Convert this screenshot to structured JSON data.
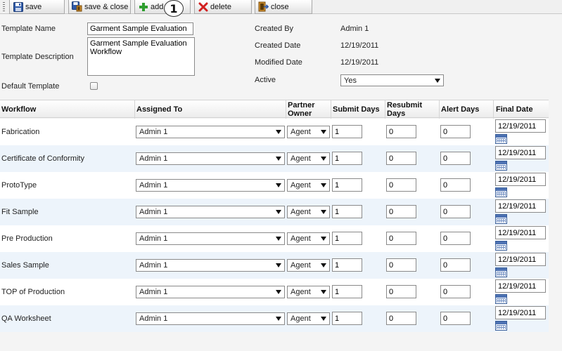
{
  "toolbar": {
    "save": "save",
    "save_close": "save & close",
    "add": "add",
    "delete": "delete",
    "close": "close",
    "badge": "1"
  },
  "form": {
    "template_name_label": "Template Name",
    "template_name_value": "Garment Sample Evaluation",
    "template_description_label": "Template Description",
    "template_description_value": "Garment Sample Evaluation Workflow",
    "default_template_label": "Default Template",
    "created_by_label": "Created By",
    "created_by_value": "Admin 1",
    "created_date_label": "Created Date",
    "created_date_value": "12/19/2011",
    "modified_date_label": "Modified Date",
    "modified_date_value": "12/19/2011",
    "active_label": "Active",
    "active_value": "Yes"
  },
  "grid": {
    "headers": {
      "workflow": "Workflow",
      "assigned_to": "Assigned To",
      "partner_owner_1": "Partner",
      "partner_owner_2": "Owner",
      "submit_days": "Submit Days",
      "resubmit_days_1": "Resubmit",
      "resubmit_days_2": "Days",
      "alert_days": "Alert Days",
      "final_date": "Final Date"
    },
    "rows": [
      {
        "workflow": "Fabrication",
        "assigned_to": "Admin 1",
        "partner_owner": "Agent",
        "submit_days": "1",
        "resubmit_days": "0",
        "alert_days": "0",
        "final_date": "12/19/2011"
      },
      {
        "workflow": "Certificate of Conformity",
        "assigned_to": "Admin 1",
        "partner_owner": "Agent",
        "submit_days": "1",
        "resubmit_days": "0",
        "alert_days": "0",
        "final_date": "12/19/2011"
      },
      {
        "workflow": "ProtoType",
        "assigned_to": "Admin 1",
        "partner_owner": "Agent",
        "submit_days": "1",
        "resubmit_days": "0",
        "alert_days": "0",
        "final_date": "12/19/2011"
      },
      {
        "workflow": "Fit Sample",
        "assigned_to": "Admin 1",
        "partner_owner": "Agent",
        "submit_days": "1",
        "resubmit_days": "0",
        "alert_days": "0",
        "final_date": "12/19/2011"
      },
      {
        "workflow": "Pre Production",
        "assigned_to": "Admin 1",
        "partner_owner": "Agent",
        "submit_days": "1",
        "resubmit_days": "0",
        "alert_days": "0",
        "final_date": "12/19/2011"
      },
      {
        "workflow": "Sales Sample",
        "assigned_to": "Admin 1",
        "partner_owner": "Agent",
        "submit_days": "1",
        "resubmit_days": "0",
        "alert_days": "0",
        "final_date": "12/19/2011"
      },
      {
        "workflow": "TOP of Production",
        "assigned_to": "Admin 1",
        "partner_owner": "Agent",
        "submit_days": "1",
        "resubmit_days": "0",
        "alert_days": "0",
        "final_date": "12/19/2011"
      },
      {
        "workflow": "QA Worksheet",
        "assigned_to": "Admin 1",
        "partner_owner": "Agent",
        "submit_days": "1",
        "resubmit_days": "0",
        "alert_days": "0",
        "final_date": "12/19/2011"
      }
    ]
  },
  "icons": {
    "save": "floppy-disk-icon",
    "save_close": "save-close-icon",
    "add": "green-plus-icon",
    "delete": "red-x-icon",
    "close": "exit-door-icon",
    "calendar": "calendar-icon"
  },
  "colors": {
    "alt_row": "#edf4fb",
    "add_green": "#2e9e2e",
    "delete_red": "#d21f1f"
  }
}
